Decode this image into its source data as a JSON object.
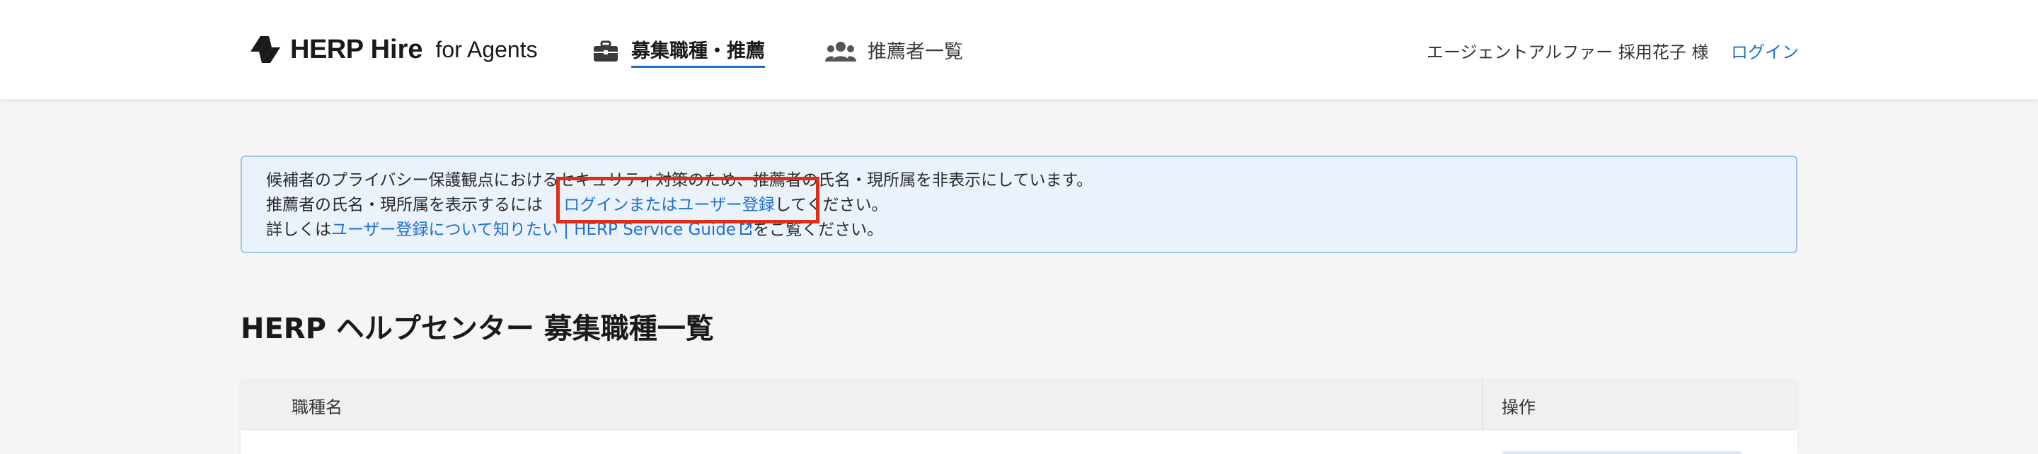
{
  "header": {
    "logo_herp": "HERP",
    "logo_hire": "Hire",
    "logo_agents": "for Agents",
    "nav_jobs_label": "募集職種・推薦",
    "nav_recommenders_label": "推薦者一覧",
    "user_name": "エージェントアルファー 採用花子 様",
    "login_label": "ログイン"
  },
  "notice": {
    "line1": "候補者のプライバシー保護観点におけるセキュリティ対策のため、推薦者の氏名・現所属を非表示にしています。",
    "line2_prefix": "推薦者の氏名・現所属を表示するには",
    "line2_link": "ログインまたはユーザー登録",
    "line2_suffix": "してください。",
    "line3_prefix": "詳しくは",
    "line3_link": "ユーザー登録について知りたい | HERP Service Guide",
    "line3_suffix": "をご覧ください。"
  },
  "page": {
    "title": "HERP ヘルプセンター 募集職種一覧"
  },
  "table": {
    "columns": [
      "職種名",
      "操作"
    ]
  },
  "colors": {
    "accent": "#1f6fd1",
    "notice_bg": "#eaf2fb",
    "notice_border": "#9fc3e8",
    "highlight": "#e02d17"
  }
}
